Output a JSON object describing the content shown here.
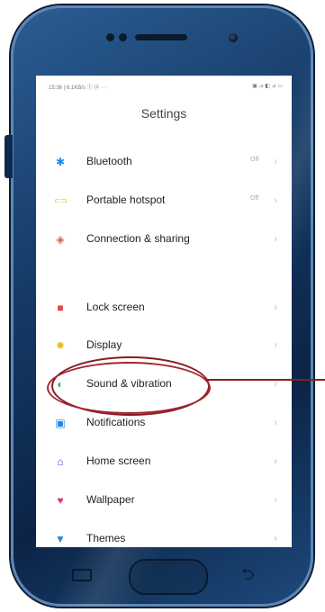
{
  "status": {
    "left": "15:36 | 6.1KB/s ⓣ ⓜ ···",
    "right": "▣ ⊿ ◧ ⊿ ▭"
  },
  "title": "Settings",
  "items": [
    {
      "label": "Bluetooth",
      "value": "Off",
      "icon": "bluetooth-icon",
      "glyph": "✱",
      "color": "#1e88e5"
    },
    {
      "label": "Portable hotspot",
      "value": "Off",
      "icon": "hotspot-icon",
      "glyph": "⊂⊃",
      "color": "#f9c11c"
    },
    {
      "label": "Connection & sharing",
      "value": "",
      "icon": "connection-icon",
      "glyph": "◈",
      "color": "#e8564d"
    },
    {
      "label": "Lock screen",
      "value": "",
      "icon": "lock-icon",
      "glyph": "■",
      "color": "#e84545"
    },
    {
      "label": "Display",
      "value": "",
      "icon": "display-icon",
      "glyph": "✹",
      "color": "#f2b91e"
    },
    {
      "label": "Sound & vibration",
      "value": "",
      "icon": "sound-icon",
      "glyph": "◐",
      "color": "#2fb36a"
    },
    {
      "label": "Notifications",
      "value": "",
      "icon": "notifications-icon",
      "glyph": "▣",
      "color": "#1e88e5"
    },
    {
      "label": "Home screen",
      "value": "",
      "icon": "home-icon",
      "glyph": "⌂",
      "color": "#5b3ec2"
    },
    {
      "label": "Wallpaper",
      "value": "",
      "icon": "wallpaper-icon",
      "glyph": "♥",
      "color": "#e0386b"
    },
    {
      "label": "Themes",
      "value": "",
      "icon": "themes-icon",
      "glyph": "▼",
      "color": "#2f86d6"
    }
  ],
  "highlight_color": "#8b1c25"
}
